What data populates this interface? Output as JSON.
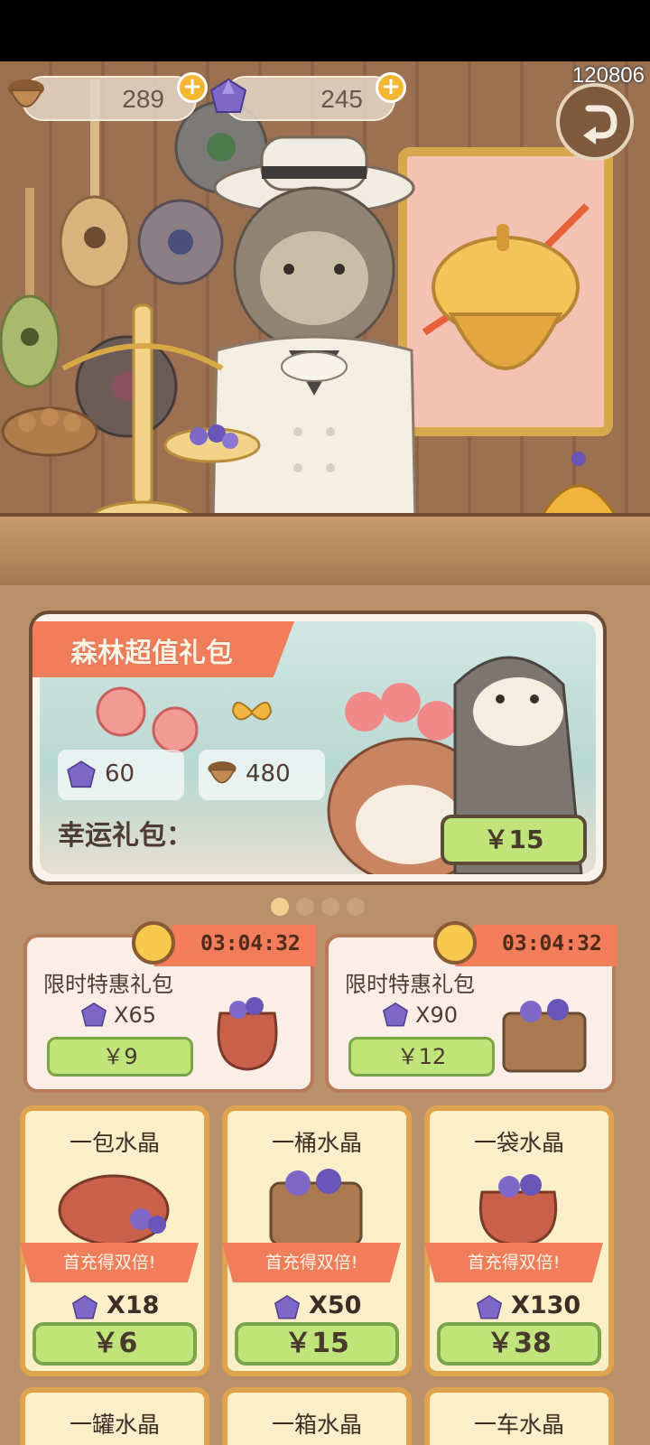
{
  "player": {
    "id": "120806"
  },
  "resources": {
    "acorns": "289",
    "crystals": "245"
  },
  "gift_pack": {
    "title": "森林超值礼包",
    "items": [
      {
        "icon": "crystal-icon",
        "amount": "60"
      },
      {
        "icon": "acorn-icon",
        "amount": "480"
      }
    ],
    "lucky_label": "幸运礼包：",
    "price": "￥15"
  },
  "carousel": {
    "pages": 4,
    "active": 0
  },
  "limited_packs": [
    {
      "timer": "03:04:32",
      "title": "限时特惠礼包",
      "quantity": "X65",
      "price": "￥9"
    },
    {
      "timer": "03:04:32",
      "title": "限时特惠礼包",
      "quantity": "X90",
      "price": "￥12"
    }
  ],
  "crystal_packs": [
    {
      "name": "一包水晶",
      "bonus": "首充得双倍!",
      "quantity": "X18",
      "price": "￥6"
    },
    {
      "name": "一桶水晶",
      "bonus": "首充得双倍!",
      "quantity": "X50",
      "price": "￥15"
    },
    {
      "name": "一袋水晶",
      "bonus": "首充得双倍!",
      "quantity": "X130",
      "price": "￥38"
    },
    {
      "name": "一罐水晶"
    },
    {
      "name": "一箱水晶"
    },
    {
      "name": "一车水晶"
    }
  ],
  "colors": {
    "accent": "#f27d5a",
    "buy_button": "#bfe47a",
    "card_border": "#e0a24d",
    "wood": "#9b7152"
  }
}
